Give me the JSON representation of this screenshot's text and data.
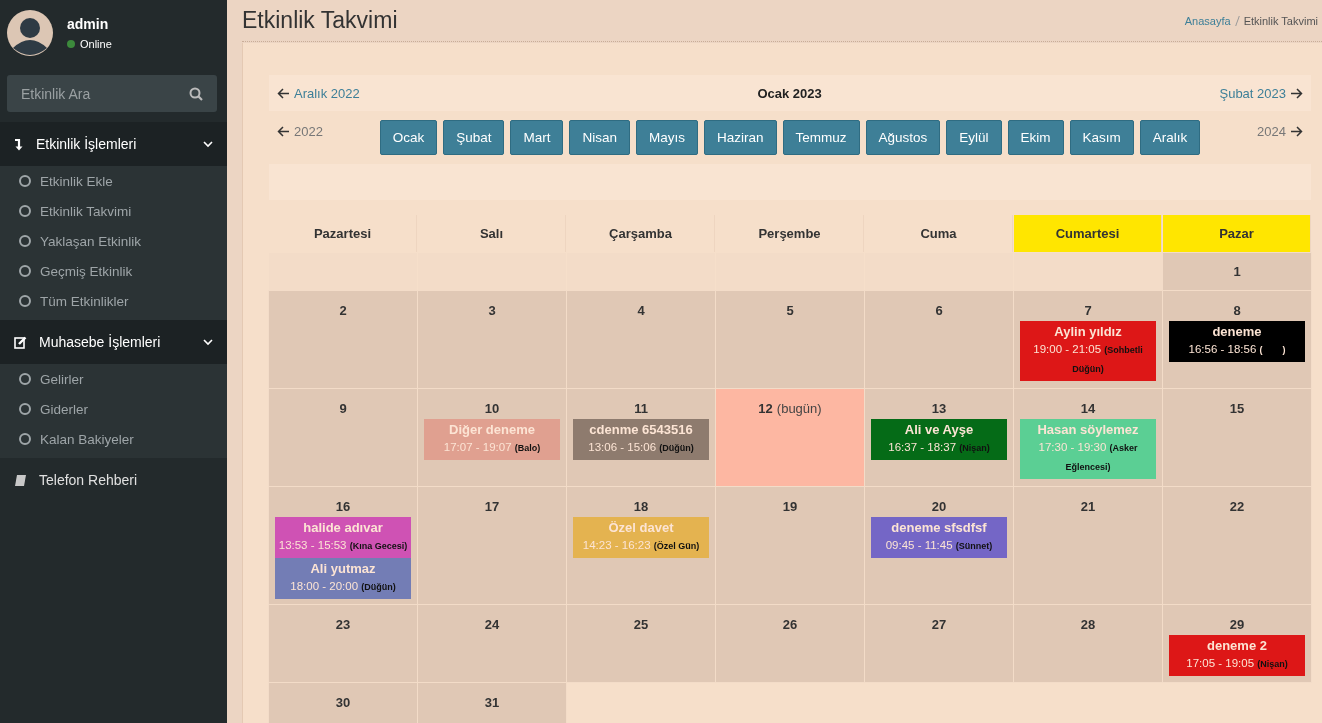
{
  "sidebar": {
    "user": {
      "name": "admin",
      "status": "Online"
    },
    "search": {
      "placeholder": "Etkinlik Ara"
    },
    "menu": [
      {
        "kind": "group",
        "label": "Etkinlik İşlemleri",
        "expanded": true,
        "children": [
          {
            "label": "Etkinlik Ekle"
          },
          {
            "label": "Etkinlik Takvimi"
          },
          {
            "label": "Yaklaşan Etkinlik"
          },
          {
            "label": "Geçmiş Etkinlik"
          },
          {
            "label": "Tüm Etkinlikler"
          }
        ]
      },
      {
        "kind": "group",
        "label": "Muhasebe İşlemleri",
        "expanded": true,
        "children": [
          {
            "label": "Gelirler"
          },
          {
            "label": "Giderler"
          },
          {
            "label": "Kalan Bakiyeler"
          }
        ]
      },
      {
        "kind": "link",
        "label": "Telefon Rehberi"
      }
    ]
  },
  "page": {
    "title": "Etkinlik Takvimi",
    "breadcrumb": [
      "Anasayfa",
      "Etkinlik Takvimi"
    ]
  },
  "nav": {
    "prev_month": "Aralık 2022",
    "current": "Ocak 2023",
    "next_month": "Şubat 2023",
    "prev_year": "2022",
    "next_year": "2024",
    "months": [
      "Ocak",
      "Şubat",
      "Mart",
      "Nisan",
      "Mayıs",
      "Haziran",
      "Temmuz",
      "Ağustos",
      "Eylül",
      "Ekim",
      "Kasım",
      "Aralık"
    ]
  },
  "calendar": {
    "weekdays": [
      {
        "label": "Pazartesi",
        "weekend": false
      },
      {
        "label": "Salı",
        "weekend": false
      },
      {
        "label": "Çarşamba",
        "weekend": false
      },
      {
        "label": "Perşembe",
        "weekend": false
      },
      {
        "label": "Cuma",
        "weekend": false
      },
      {
        "label": "Cumartesi",
        "weekend": true
      },
      {
        "label": "Pazar",
        "weekend": true
      }
    ],
    "weeks": [
      [
        {
          "day": "1",
          "today": false
        }
      ],
      [
        {
          "day": "2",
          "today": false
        },
        {
          "day": "3",
          "today": false
        },
        {
          "day": "4",
          "today": false
        },
        {
          "day": "5",
          "today": false
        },
        {
          "day": "6",
          "today": false
        },
        {
          "day": "7",
          "today": false,
          "events": [
            {
              "title": "Aylin yıldız",
              "time": "19:00 - 21:05",
              "type": "(Sohbetli Düğün)",
              "color": "#dd1717"
            }
          ]
        },
        {
          "day": "8",
          "today": false,
          "events": [
            {
              "title": "deneme",
              "time": "16:56 - 18:56",
              "type": "(        )",
              "color": "#000000"
            }
          ]
        }
      ],
      [
        {
          "day": "9",
          "today": false
        },
        {
          "day": "10",
          "today": false,
          "events": [
            {
              "title": "Diğer deneme",
              "time": "17:07 - 19:07",
              "type": "(Balo)",
              "color": "#e0a090"
            }
          ]
        },
        {
          "day": "11",
          "today": false,
          "events": [
            {
              "title": "cdenme 6543516",
              "time": "13:06 - 15:06",
              "type": "(Düğün)",
              "color": "#8e7b6e"
            }
          ]
        },
        {
          "day": "12",
          "today": true,
          "today_label": "(bugün)"
        },
        {
          "day": "13",
          "today": false,
          "events": [
            {
              "title": "Ali ve Ayşe",
              "time": "16:37 - 18:37",
              "type": "(Nişan)",
              "color": "#056b17"
            }
          ]
        },
        {
          "day": "14",
          "today": false,
          "events": [
            {
              "title": "Hasan söylemez",
              "time": "17:30 - 19:30",
              "type": "(Asker Eğlencesi)",
              "color": "#5bcf94"
            }
          ]
        },
        {
          "day": "15",
          "today": false
        }
      ],
      [
        {
          "day": "16",
          "today": false,
          "events": [
            {
              "title": "halide adıvar",
              "time": "13:53 - 15:53",
              "type": "(Kına Gecesi)",
              "color": "#cf52b4"
            },
            {
              "title": "Ali yutmaz",
              "time": "18:00 - 20:00",
              "type": "(Düğün)",
              "color": "#737db5"
            }
          ]
        },
        {
          "day": "17",
          "today": false
        },
        {
          "day": "18",
          "today": false,
          "events": [
            {
              "title": "Özel davet",
              "time": "14:23 - 16:23",
              "type": "(Özel Gün)",
              "color": "#e4b350"
            }
          ]
        },
        {
          "day": "19",
          "today": false
        },
        {
          "day": "20",
          "today": false,
          "events": [
            {
              "title": "deneme sfsdfsf",
              "time": "09:45 - 11:45",
              "type": "(Sünnet)",
              "color": "#7466c6"
            }
          ]
        },
        {
          "day": "21",
          "today": false
        },
        {
          "day": "22",
          "today": false
        }
      ],
      [
        {
          "day": "23",
          "today": false
        },
        {
          "day": "24",
          "today": false
        },
        {
          "day": "25",
          "today": false
        },
        {
          "day": "26",
          "today": false
        },
        {
          "day": "27",
          "today": false
        },
        {
          "day": "28",
          "today": false
        },
        {
          "day": "29",
          "today": false,
          "events": [
            {
              "title": "deneme 2",
              "time": "17:05 - 19:05",
              "type": "(Nişan)",
              "color": "#dd1717"
            }
          ]
        }
      ],
      [
        {
          "day": "30",
          "today": false
        },
        {
          "day": "31",
          "today": false
        }
      ]
    ]
  }
}
